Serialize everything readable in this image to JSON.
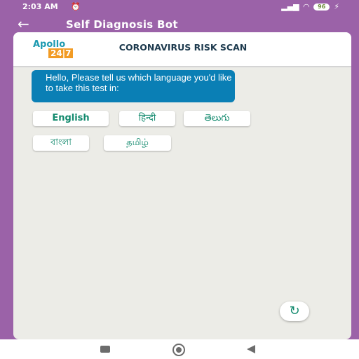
{
  "status_bar": {
    "time": "2:03 AM",
    "alarm_icon": "alarm-clock-icon",
    "signal_icon": "signal-icon",
    "wifi_icon": "wifi-icon",
    "battery": "96"
  },
  "app_bar": {
    "back_icon": "←",
    "title": "Self Diagnosis Bot"
  },
  "header": {
    "logo_text": "Apollo",
    "logo_box": "24|7",
    "title": "CORONAVIRUS RISK SCAN"
  },
  "chat": {
    "bot_message": "Hello, Please tell us which language you'd like to take this test in:"
  },
  "languages": [
    "English",
    "हिन्दी",
    "తెలుగు",
    "বাংলা",
    "தமிழ்"
  ],
  "refresh_icon": "↻",
  "colors": {
    "frame": "#9b62a8",
    "bubble": "#0a7fb5",
    "accent": "#138a6e",
    "logo_orange": "#f29b24"
  }
}
